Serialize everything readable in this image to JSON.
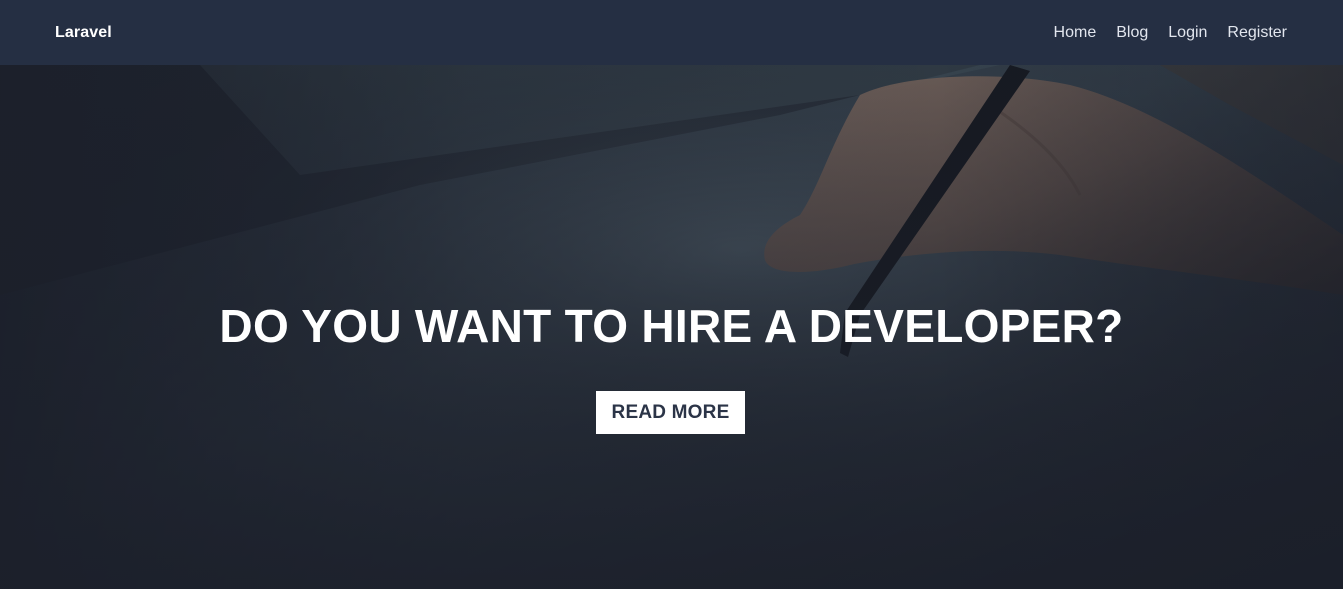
{
  "navbar": {
    "brand": "Laravel",
    "links": [
      {
        "label": "Home"
      },
      {
        "label": "Blog"
      },
      {
        "label": "Login"
      },
      {
        "label": "Register"
      }
    ]
  },
  "hero": {
    "title": "DO YOU WANT TO HIRE A DEVELOPER?",
    "button_label": "READ MORE"
  },
  "colors": {
    "navbar_bg": "#252f43",
    "hero_overlay": "#1e232e",
    "button_bg": "#ffffff",
    "button_text": "#2b3447"
  }
}
